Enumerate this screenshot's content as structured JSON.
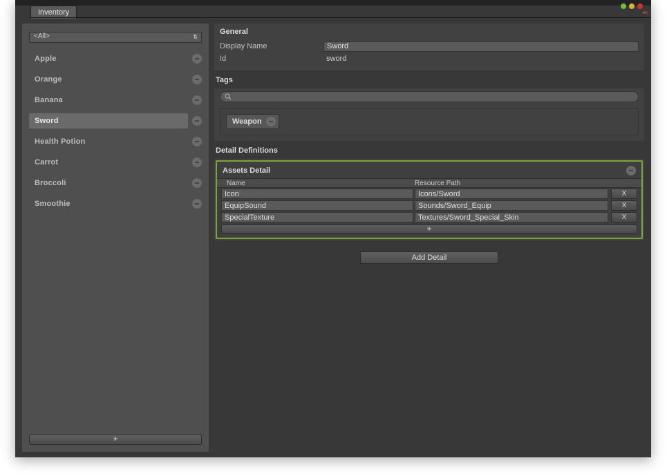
{
  "window": {
    "tab": "Inventory"
  },
  "sidebar": {
    "filter": "<All>",
    "add_label": "+",
    "items": [
      {
        "label": "Apple",
        "selected": false
      },
      {
        "label": "Orange",
        "selected": false
      },
      {
        "label": "Banana",
        "selected": false
      },
      {
        "label": "Sword",
        "selected": true
      },
      {
        "label": "Health Potion",
        "selected": false
      },
      {
        "label": "Carrot",
        "selected": false
      },
      {
        "label": "Broccoli",
        "selected": false
      },
      {
        "label": "Smoothie",
        "selected": false
      }
    ]
  },
  "general": {
    "title": "General",
    "display_name_label": "Display Name",
    "display_name_value": "Sword",
    "id_label": "Id",
    "id_value": "sword"
  },
  "tags": {
    "title": "Tags",
    "search": "",
    "chips": [
      {
        "label": "Weapon"
      }
    ]
  },
  "definitions": {
    "title": "Detail Definitions",
    "panel_title": "Assets Detail",
    "col_name": "Name",
    "col_path": "Resource Path",
    "rows": [
      {
        "name": "Icon",
        "path": "Icons/Sword"
      },
      {
        "name": "EquipSound",
        "path": "Sounds/Sword_Equip"
      },
      {
        "name": "SpecialTexture",
        "path": "Textures/Sword_Special_Skin"
      }
    ],
    "row_delete_label": "X",
    "row_add_label": "+",
    "add_detail_label": "Add Detail"
  }
}
